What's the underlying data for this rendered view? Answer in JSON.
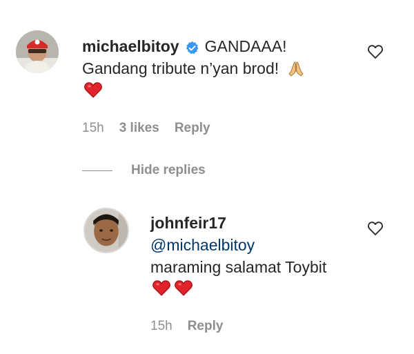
{
  "comment": {
    "username": "michaelbitoy",
    "verified": true,
    "text_line1": "GANDAAA!",
    "text_line2": "Gandang tribute n’yan brod!",
    "emoji_line2": "folded-hands-emoji",
    "emoji_line3": [
      "red-heart-emoji"
    ],
    "time": "15h",
    "likes": "3 likes",
    "reply_label": "Reply"
  },
  "thread": {
    "hide_replies_label": "Hide replies"
  },
  "reply": {
    "username": "johnfeir17",
    "mention": "@michaelbitoy",
    "text": "maraming salamat Toybit",
    "emojis": [
      "red-heart-emoji",
      "red-heart-emoji"
    ],
    "time": "15h",
    "reply_label": "Reply"
  },
  "colors": {
    "text": "#262626",
    "muted": "#8e8e8e",
    "mention": "#00376b",
    "verified": "#3897f0",
    "heart": "#e0242b"
  },
  "icons": {
    "like": "heart-outline-icon",
    "verified": "verified-badge-icon"
  }
}
